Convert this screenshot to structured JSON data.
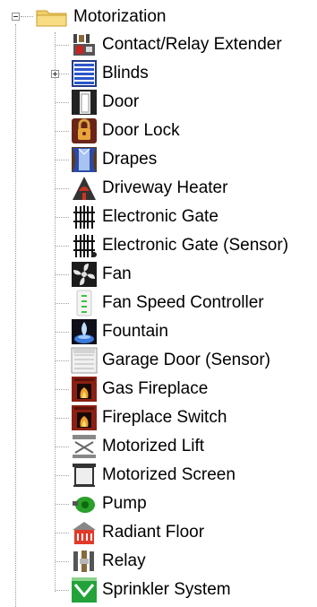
{
  "root": {
    "label": "Motorization",
    "icon": "folder-icon",
    "expanded": true
  },
  "items": [
    {
      "label": "Contact/Relay Extender",
      "icon": "contact-relay-extender-icon"
    },
    {
      "label": "Blinds",
      "icon": "blinds-icon",
      "has_children": true
    },
    {
      "label": "Door",
      "icon": "door-icon"
    },
    {
      "label": "Door Lock",
      "icon": "door-lock-icon"
    },
    {
      "label": "Drapes",
      "icon": "drapes-icon"
    },
    {
      "label": "Driveway Heater",
      "icon": "driveway-heater-icon"
    },
    {
      "label": "Electronic Gate",
      "icon": "electronic-gate-icon"
    },
    {
      "label": "Electronic Gate (Sensor)",
      "icon": "electronic-gate-sensor-icon"
    },
    {
      "label": "Fan",
      "icon": "fan-icon"
    },
    {
      "label": "Fan Speed Controller",
      "icon": "fan-speed-controller-icon"
    },
    {
      "label": "Fountain",
      "icon": "fountain-icon"
    },
    {
      "label": "Garage Door (Sensor)",
      "icon": "garage-door-sensor-icon"
    },
    {
      "label": "Gas Fireplace",
      "icon": "gas-fireplace-icon"
    },
    {
      "label": "Fireplace Switch",
      "icon": "fireplace-switch-icon"
    },
    {
      "label": "Motorized Lift",
      "icon": "motorized-lift-icon"
    },
    {
      "label": "Motorized Screen",
      "icon": "motorized-screen-icon"
    },
    {
      "label": "Pump",
      "icon": "pump-icon"
    },
    {
      "label": "Radiant Floor",
      "icon": "radiant-floor-icon"
    },
    {
      "label": "Relay",
      "icon": "relay-icon"
    },
    {
      "label": "Sprinkler System",
      "icon": "sprinkler-system-icon"
    }
  ]
}
